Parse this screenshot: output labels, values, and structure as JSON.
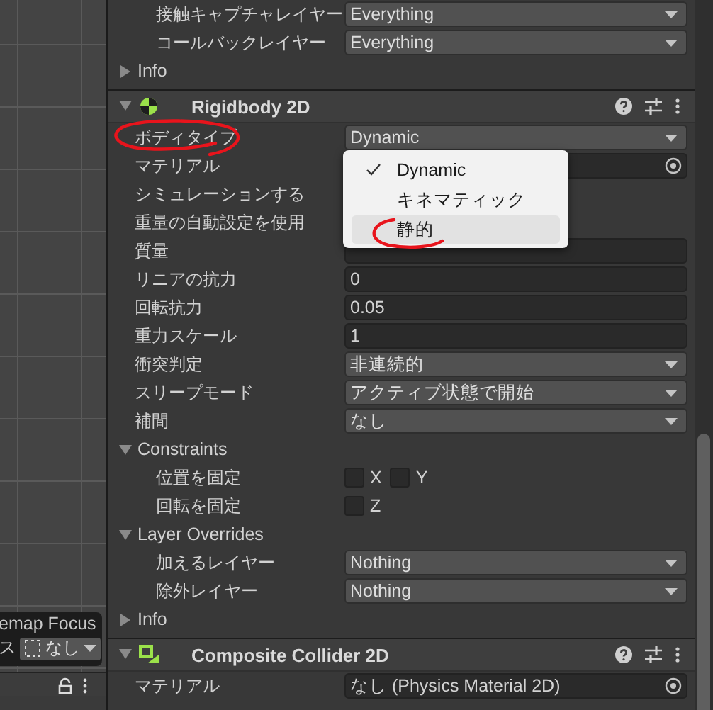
{
  "scene": {
    "overlay_title": "emap Focus",
    "overlay_label": "ス",
    "focus_value": "なし"
  },
  "inspector": {
    "top_rows": [
      {
        "kind": "group",
        "children": [
          {
            "kind": "dropdown",
            "label": "接触キャプチャレイヤー",
            "value": "Everything"
          },
          {
            "kind": "dropdown",
            "label": "コールバックレイヤー",
            "value": "Everything"
          }
        ]
      },
      {
        "kind": "foldout",
        "label": "Info",
        "expanded": false,
        "children": []
      }
    ],
    "components": [
      {
        "title": "Rigidbody 2D",
        "expanded": true,
        "rows": [
          {
            "kind": "dropdown",
            "label": "ボディタイプ",
            "value": "Dynamic",
            "highlight": true
          },
          {
            "kind": "object",
            "label": "マテリアル"
          },
          {
            "kind": "field",
            "label": "シミュレーションする"
          },
          {
            "kind": "field",
            "label": "重量の自動設定を使用"
          },
          {
            "kind": "number",
            "label": "質量"
          },
          {
            "kind": "number",
            "label": "リニアの抗力",
            "value": "0"
          },
          {
            "kind": "number",
            "label": "回転抗力",
            "value": "0.05"
          },
          {
            "kind": "number",
            "label": "重力スケール",
            "value": "1"
          },
          {
            "kind": "dropdown",
            "label": "衝突判定",
            "value": "非連続的"
          },
          {
            "kind": "dropdown",
            "label": "スリープモード",
            "value": "アクティブ状態で開始"
          },
          {
            "kind": "dropdown",
            "label": "補間",
            "value": "なし"
          },
          {
            "kind": "foldout",
            "label": "Constraints",
            "expanded": true,
            "children": [
              {
                "kind": "checks",
                "label": "位置を固定",
                "boxes": [
                  {
                    "label": "X",
                    "checked": false
                  },
                  {
                    "label": "Y",
                    "checked": false
                  }
                ]
              },
              {
                "kind": "checks",
                "label": "回転を固定",
                "boxes": [
                  {
                    "label": "Z",
                    "checked": false
                  }
                ]
              }
            ]
          },
          {
            "kind": "foldout",
            "label": "Layer Overrides",
            "expanded": true,
            "children": [
              {
                "kind": "dropdown",
                "label": "加えるレイヤー",
                "value": "Nothing"
              },
              {
                "kind": "dropdown",
                "label": "除外レイヤー",
                "value": "Nothing"
              }
            ]
          },
          {
            "kind": "foldout",
            "label": "Info",
            "expanded": false,
            "children": []
          }
        ]
      },
      {
        "title": "Composite Collider 2D",
        "expanded": true,
        "rows": [
          {
            "kind": "object",
            "label": "マテリアル",
            "value": "なし (Physics Material 2D)"
          }
        ]
      }
    ],
    "popup": {
      "items": [
        {
          "label": "Dynamic",
          "checked": true,
          "hovered": false,
          "highlight": false
        },
        {
          "label": "キネマティック",
          "checked": false,
          "hovered": false,
          "highlight": false
        },
        {
          "label": "静的",
          "checked": false,
          "hovered": true,
          "highlight": true
        }
      ]
    }
  }
}
